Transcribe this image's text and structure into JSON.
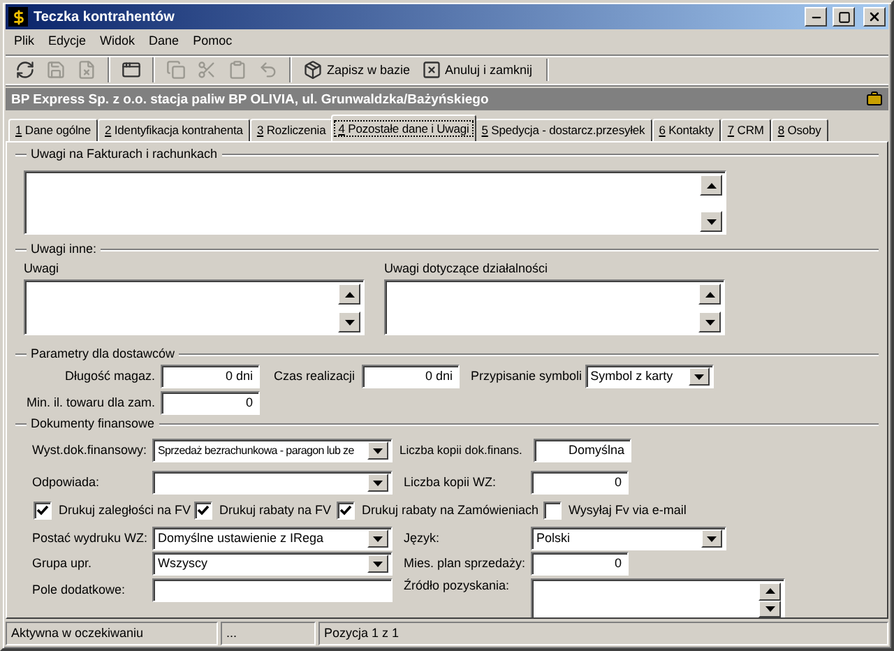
{
  "window": {
    "title": "Teczka kontrahentów"
  },
  "menu": [
    {
      "label": "Plik"
    },
    {
      "label": "Edycje"
    },
    {
      "label": "Widok"
    },
    {
      "label": "Dane"
    },
    {
      "label": "Pomoc"
    }
  ],
  "toolbar": [
    {
      "kind": "icon",
      "disabled": false
    },
    {
      "kind": "icon",
      "disabled": true
    },
    {
      "kind": "icon",
      "disabled": true
    },
    {
      "kind": "separator"
    },
    {
      "kind": "icon",
      "disabled": false
    },
    {
      "kind": "separator"
    },
    {
      "kind": "icon",
      "disabled": true
    },
    {
      "kind": "icon",
      "disabled": true
    },
    {
      "kind": "icon",
      "disabled": true
    },
    {
      "kind": "icon",
      "disabled": true
    },
    {
      "kind": "separator"
    },
    {
      "kind": "text",
      "label": "Zapisz w bazie",
      "disabled": false
    },
    {
      "kind": "text",
      "label": "Anuluj i zamknij",
      "disabled": false
    }
  ],
  "company": {
    "name": "BP Express Sp. z o.o.  stacja paliw BP OLIVIA, ul. Grunwaldzka/Bażyńskiego"
  },
  "tabs": [
    {
      "key": "1",
      "label": "Dane ogólne",
      "selected": false
    },
    {
      "key": "2",
      "label": "Identyfikacja kontrahenta",
      "selected": false
    },
    {
      "key": "3",
      "label": "Rozliczenia",
      "selected": false
    },
    {
      "key": "4",
      "label": "Pozostałe dane i Uwagi",
      "selected": true
    },
    {
      "key": "5",
      "label": "Spedycja - dostarcz.przesyłek",
      "selected": false
    },
    {
      "key": "6",
      "label": "Kontakty",
      "selected": false
    },
    {
      "key": "7",
      "label": "CRM",
      "selected": false
    },
    {
      "key": "8",
      "label": "Osoby",
      "selected": false
    }
  ],
  "invoice_notes": {
    "legend": "Uwagi na Fakturach i rachunkach"
  },
  "other_notes": {
    "legend": "Uwagi inne:",
    "fields": [
      {
        "label": "Uwagi"
      },
      {
        "label": "Uwagi dotyczące działalności"
      }
    ]
  },
  "supplier_params": {
    "legend": "Parametry dla dostawców",
    "storage_length": {
      "label": "Długość magaz.",
      "value": "0 dni"
    },
    "lead_time": {
      "label": "Czas realizacji",
      "value": "0 dni"
    },
    "symbol_assignment": {
      "label": "Przypisanie symboli",
      "value": "Symbol z karty"
    },
    "min_quantity": {
      "label": "Min. il. towaru dla zam.",
      "value": "0"
    }
  },
  "financial_docs": {
    "legend": "Dokumenty finansowe",
    "doc_type": {
      "label": "Wyst.dok.finansowy:",
      "value": "Sprzedaż bezrachunkowa - paragon lub ze"
    },
    "copies_fin": {
      "label": "Liczba kopii dok.finans.",
      "value": "Domyślna"
    },
    "responsible": {
      "label": "Odpowiada:"
    },
    "copies_wz": {
      "label": "Liczba kopii WZ:",
      "value": "0"
    },
    "checkboxes": [
      {
        "label": "Drukuj zaległości na FV",
        "checked": true
      },
      {
        "label": "Drukuj rabaty na FV",
        "checked": true
      },
      {
        "label": "Drukuj rabaty na Zamówieniach",
        "checked": true
      },
      {
        "label": "Wysyłaj Fv via e-mail",
        "checked": false
      }
    ],
    "wz_format": {
      "label": "Postać wydruku WZ:",
      "value": "Domyślne ustawienie z IRega"
    },
    "language": {
      "label": "Język:",
      "value": "Polski"
    },
    "group": {
      "label": "Grupa upr.",
      "value": "Wszyscy"
    },
    "sales_plan": {
      "label": "Mies. plan sprzedaży:",
      "value": "0"
    },
    "extra_field": {
      "label": "Pole dodatkowe:"
    },
    "source": {
      "label": "Źródło pozyskania:"
    }
  },
  "status_bar": [
    {
      "text": "Aktywna w oczekiwaniu"
    },
    {
      "text": "..."
    },
    {
      "text": "Pozycja 1 z 1"
    }
  ]
}
